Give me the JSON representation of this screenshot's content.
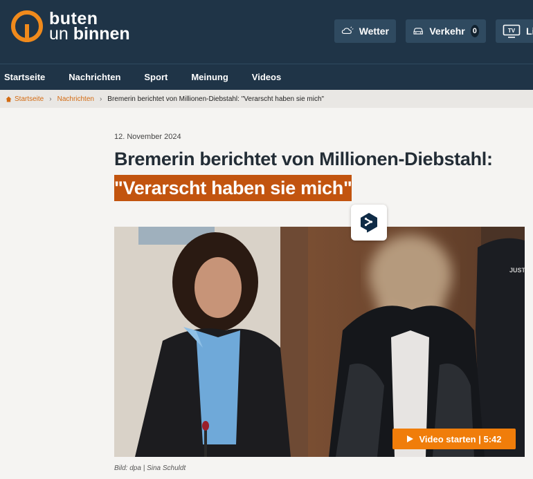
{
  "header": {
    "logo_line1": "buten",
    "logo_line2_a": "un",
    "logo_line2_b": "binnen",
    "buttons": [
      {
        "label": "Wetter",
        "icon": "weather-icon"
      },
      {
        "label": "Verkehr",
        "icon": "car-icon",
        "badge": "0"
      },
      {
        "label": "Li",
        "icon": "tv-icon"
      }
    ],
    "tv_icon_text": "TV"
  },
  "nav": {
    "items": [
      "Startseite",
      "Nachrichten",
      "Sport",
      "Meinung",
      "Videos"
    ]
  },
  "breadcrumb": {
    "items": [
      "Startseite",
      "Nachrichten"
    ],
    "current": "Bremerin berichtet von Millionen-Diebstahl: \"Verarscht haben sie mich\""
  },
  "article": {
    "date": "12. November 2024",
    "title_line1": "Bremerin berichtet von Millionen-Diebstahl:",
    "title_line2": "\"Verarscht haben sie mich\"",
    "video_button": "Video starten | 5:42",
    "caption": "Bild: dpa | Sina Schuldt",
    "photo_text": "JUSTI"
  },
  "colors": {
    "header_bg": "#1f3447",
    "accent": "#f08a1c",
    "title_highlight": "#c2540f",
    "video_button": "#f07d0a"
  }
}
